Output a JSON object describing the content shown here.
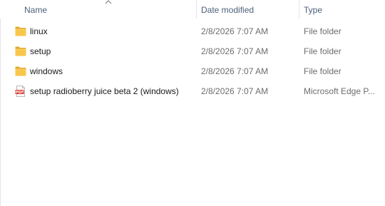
{
  "header": {
    "name": "Name",
    "date_modified": "Date modified",
    "type": "Type",
    "sort_indicator_icon": "chevron-up-icon"
  },
  "files": [
    {
      "name": "linux",
      "date": "2/8/2026 7:07 AM",
      "type": "File folder",
      "icon": "folder-icon"
    },
    {
      "name": "setup",
      "date": "2/8/2026 7:07 AM",
      "type": "File folder",
      "icon": "folder-icon"
    },
    {
      "name": "windows",
      "date": "2/8/2026 7:07 AM",
      "type": "File folder",
      "icon": "folder-icon"
    },
    {
      "name": "setup radioberry juice beta 2 (windows)",
      "date": "2/8/2026 7:07 AM",
      "type": "Microsoft Edge P...",
      "icon": "pdf-icon"
    }
  ],
  "colors": {
    "folder": "#f8c64a",
    "pdf": "#d93025",
    "header_text": "#4c607a"
  }
}
